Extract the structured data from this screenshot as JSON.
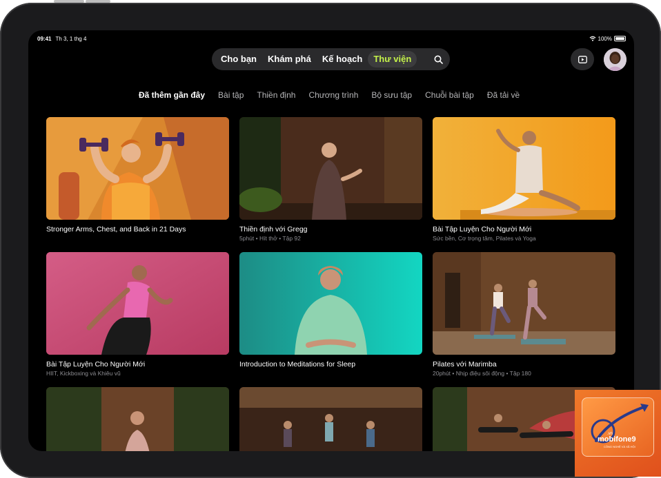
{
  "status": {
    "time": "09:41",
    "date": "Th 3, 1 thg 4",
    "battery": "100%"
  },
  "nav": {
    "tabs": [
      {
        "label": "Cho bạn",
        "active": false
      },
      {
        "label": "Khám phá",
        "active": false
      },
      {
        "label": "Kế hoạch",
        "active": false
      },
      {
        "label": "Thư viện",
        "active": true
      }
    ],
    "search_icon": "search-icon",
    "tv_icon": "play-rectangle-icon",
    "accent": "#c4f24a"
  },
  "filters": [
    "Đã thêm gần đây",
    "Bài tập",
    "Thiền định",
    "Chương trình",
    "Bộ sưu tập",
    "Chuỗi bài tập",
    "Đã tải về"
  ],
  "cards": [
    {
      "title": "Stronger Arms, Chest, and Back in 21 Days",
      "subtitle": ""
    },
    {
      "title": "Thiền định với Gregg",
      "subtitle": "5phút • Hít thở • Tập 92"
    },
    {
      "title": "Bài Tập Luyện Cho Người Mới",
      "subtitle": "Sức bền, Cơ trọng tâm, Pilates và Yoga"
    },
    {
      "title": "Bài Tập Luyện Cho Người Mới",
      "subtitle": "HIIT, Kickboxing và Khiêu vũ"
    },
    {
      "title": "Introduction to Meditations for Sleep",
      "subtitle": ""
    },
    {
      "title": "Pilates với Marimba",
      "subtitle": "20phút • Nhịp điệu sôi động • Tập 180"
    }
  ],
  "watermark": {
    "brand": "mobifone9",
    "domain": ".vn",
    "tagline": "CÔNG NGHỆ VÀ XÃ HỘI"
  }
}
